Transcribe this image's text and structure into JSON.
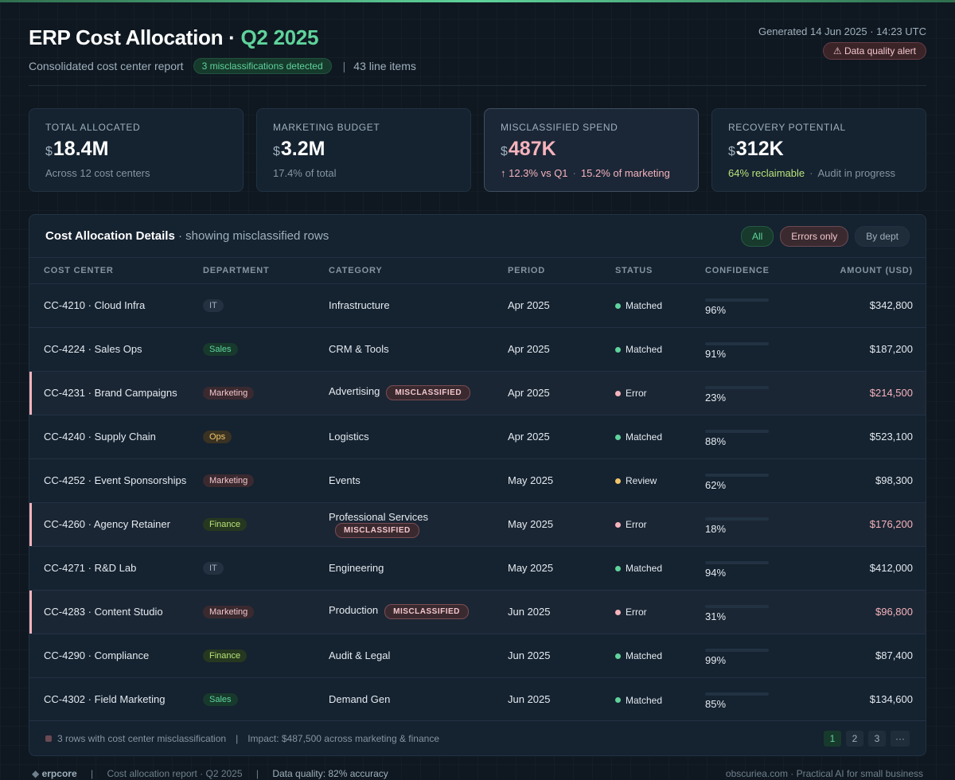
{
  "header": {
    "title_main": "ERP Cost Allocation ·",
    "title_period": "Q2 2025",
    "subtitle": "Consolidated cost center report",
    "misclass_badge": "3 misclassifications detected",
    "separator": "|",
    "line_items": "43 line items",
    "generated": "Generated 14 Jun 2025 · 14:23 UTC",
    "alert_icon": "⚠",
    "alert_label": "Data quality alert"
  },
  "kpis": [
    {
      "label": "TOTAL ALLOCATED",
      "currency": "$",
      "value": "18.4M",
      "sub": "Across 12 cost centers"
    },
    {
      "label": "MARKETING BUDGET",
      "currency": "$",
      "value": "3.2M",
      "sub": "17.4% of total"
    },
    {
      "label": "MISCLASSIFIED SPEND",
      "currency": "$",
      "value": "487K",
      "sub_a": "↑ 12.3% vs Q1",
      "sub_dot": "·",
      "sub_b": "15.2% of marketing"
    },
    {
      "label": "RECOVERY POTENTIAL",
      "currency": "$",
      "value": "312K",
      "sub_a": "64% reclaimable",
      "sub_dot": "·",
      "sub_b": "Audit in progress"
    }
  ],
  "panel": {
    "title": "Cost Allocation Details",
    "title_muted": "· showing misclassified rows",
    "filters": [
      "All",
      "Errors only",
      "By dept"
    ]
  },
  "table": {
    "columns": [
      "COST CENTER",
      "DEPARTMENT",
      "CATEGORY",
      "PERIOD",
      "STATUS",
      "CONFIDENCE",
      "AMOUNT (USD)"
    ],
    "misclassified_label": "MISCLASSIFIED",
    "rows": [
      {
        "center": "CC-4210 · Cloud Infra",
        "dept": "IT",
        "category": "Infrastructure",
        "period": "Apr 2025",
        "status": "Matched",
        "confidence": "96%",
        "amount": "$342,800"
      },
      {
        "center": "CC-4224 · Sales Ops",
        "dept": "Sales",
        "category": "CRM & Tools",
        "period": "Apr 2025",
        "status": "Matched",
        "confidence": "91%",
        "amount": "$187,200"
      },
      {
        "center": "CC-4231 · Brand Campaigns",
        "dept": "Marketing",
        "category": "Advertising",
        "period": "Apr 2025",
        "status": "Error",
        "confidence": "23%",
        "amount": "$214,500"
      },
      {
        "center": "CC-4240 · Supply Chain",
        "dept": "Ops",
        "category": "Logistics",
        "period": "Apr 2025",
        "status": "Matched",
        "confidence": "88%",
        "amount": "$523,100"
      },
      {
        "center": "CC-4252 · Event Sponsorships",
        "dept": "Marketing",
        "category": "Events",
        "period": "May 2025",
        "status": "Review",
        "confidence": "62%",
        "amount": "$98,300"
      },
      {
        "center": "CC-4260 · Agency Retainer",
        "dept": "Finance",
        "category": "Professional Services",
        "period": "May 2025",
        "status": "Error",
        "confidence": "18%",
        "amount": "$176,200"
      },
      {
        "center": "CC-4271 · R&D Lab",
        "dept": "IT",
        "category": "Engineering",
        "period": "May 2025",
        "status": "Matched",
        "confidence": "94%",
        "amount": "$412,000"
      },
      {
        "center": "CC-4283 · Content Studio",
        "dept": "Marketing",
        "category": "Production",
        "period": "Jun 2025",
        "status": "Error",
        "confidence": "31%",
        "amount": "$96,800"
      },
      {
        "center": "CC-4290 · Compliance",
        "dept": "Finance",
        "category": "Audit & Legal",
        "period": "Jun 2025",
        "status": "Matched",
        "confidence": "99%",
        "amount": "$87,400"
      },
      {
        "center": "CC-4302 · Field Marketing",
        "dept": "Sales",
        "category": "Demand Gen",
        "period": "Jun 2025",
        "status": "Matched",
        "confidence": "85%",
        "amount": "$134,600"
      }
    ]
  },
  "panel_footer": {
    "rows_note": "3 rows with cost center misclassification",
    "separator": "|",
    "impact": "Impact: $487,500 across marketing & finance",
    "pages": [
      "1",
      "2",
      "3",
      "···"
    ]
  },
  "footer": {
    "brand_icon": "◆",
    "brand_a": "erp",
    "brand_b": "core",
    "sep": "|",
    "report": "Cost allocation report · Q2 2025",
    "quality": "Data quality: 82% accuracy",
    "credit": "obscuriea.com · Practical AI for small business"
  },
  "colors": {
    "accent": "#5fd39b",
    "error": "#f6b3bc",
    "review": "#f3c56a",
    "background": "#0f1821"
  }
}
